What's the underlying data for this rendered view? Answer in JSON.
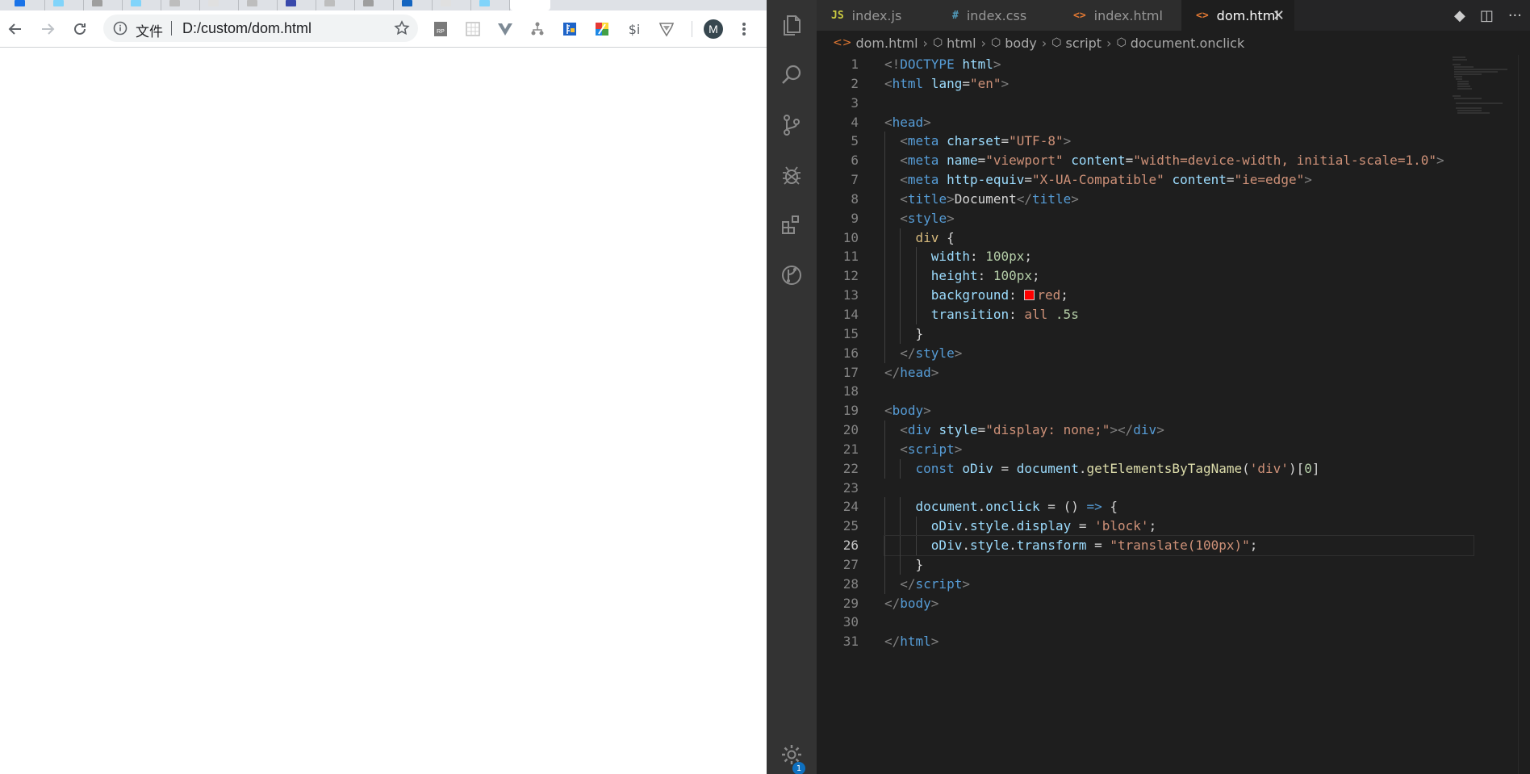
{
  "browser": {
    "tabs": [
      {
        "color": "#1a73e8"
      },
      {
        "color": "#81d4fa"
      },
      {
        "color": "#9e9e9e"
      },
      {
        "color": "#81d4fa"
      },
      {
        "color": "#bdbdbd"
      },
      {
        "color": "#e0e0e0"
      },
      {
        "color": "#bdbdbd"
      },
      {
        "color": "#3949ab"
      },
      {
        "color": "#bdbdbd"
      },
      {
        "color": "#9e9e9e"
      },
      {
        "color": "#1565c0"
      },
      {
        "color": "#e0e0e0"
      },
      {
        "color": "#81d4fa"
      }
    ],
    "address": {
      "security_chip": "文件",
      "url": "D:/custom/dom.html"
    },
    "extensions": [
      {
        "icon": "rp-icon",
        "label": ""
      },
      {
        "icon": "grid-icon",
        "label": ""
      },
      {
        "icon": "vue-devtools-icon",
        "label": ""
      },
      {
        "icon": "tree-icon",
        "label": ""
      },
      {
        "icon": "ruler-icon",
        "label": ""
      },
      {
        "icon": "colorful-square-icon",
        "label": ""
      },
      {
        "icon": "dollar-i-icon",
        "label": "$i"
      },
      {
        "icon": "shield-icon",
        "label": ""
      }
    ],
    "profile_initial": "M"
  },
  "vscode": {
    "tabs": [
      {
        "icon_text": "JS",
        "icon_color": "#cbcb41",
        "label": "index.js"
      },
      {
        "icon_text": "#",
        "icon_color": "#519aba",
        "label": "index.css"
      },
      {
        "icon_text": "<>",
        "icon_color": "#e37933",
        "label": "index.html"
      },
      {
        "icon_text": "<>",
        "icon_color": "#e37933",
        "label": "dom.html",
        "active": true
      }
    ],
    "breadcrumbs": [
      "dom.html",
      "html",
      "body",
      "script",
      "document.onclick"
    ],
    "notification_count": "1",
    "current_line": 26,
    "code_lines": [
      [
        [
          "t-bkt",
          "<!"
        ],
        [
          "t-tag",
          "DOCTYPE "
        ],
        [
          "t-attr",
          "html"
        ],
        [
          "t-bkt",
          ">"
        ]
      ],
      [
        [
          "t-bkt",
          "<"
        ],
        [
          "t-tag",
          "html "
        ],
        [
          "t-attr",
          "lang"
        ],
        [
          "t-txt",
          "="
        ],
        [
          "t-str",
          "\"en\""
        ],
        [
          "t-bkt",
          ">"
        ]
      ],
      [],
      [
        [
          "t-bkt",
          "<"
        ],
        [
          "t-tag",
          "head"
        ],
        [
          "t-bkt",
          ">"
        ]
      ],
      [
        [
          "t-txt",
          "  "
        ],
        [
          "t-bkt",
          "<"
        ],
        [
          "t-tag",
          "meta "
        ],
        [
          "t-attr",
          "charset"
        ],
        [
          "t-txt",
          "="
        ],
        [
          "t-str",
          "\"UTF-8\""
        ],
        [
          "t-bkt",
          ">"
        ]
      ],
      [
        [
          "t-txt",
          "  "
        ],
        [
          "t-bkt",
          "<"
        ],
        [
          "t-tag",
          "meta "
        ],
        [
          "t-attr",
          "name"
        ],
        [
          "t-txt",
          "="
        ],
        [
          "t-str",
          "\"viewport\" "
        ],
        [
          "t-attr",
          "content"
        ],
        [
          "t-txt",
          "="
        ],
        [
          "t-str",
          "\"width=device-width, initial-scale=1.0\""
        ],
        [
          "t-bkt",
          ">"
        ]
      ],
      [
        [
          "t-txt",
          "  "
        ],
        [
          "t-bkt",
          "<"
        ],
        [
          "t-tag",
          "meta "
        ],
        [
          "t-attr",
          "http-equiv"
        ],
        [
          "t-txt",
          "="
        ],
        [
          "t-str",
          "\"X-UA-Compatible\" "
        ],
        [
          "t-attr",
          "content"
        ],
        [
          "t-txt",
          "="
        ],
        [
          "t-str",
          "\"ie=edge\""
        ],
        [
          "t-bkt",
          ">"
        ]
      ],
      [
        [
          "t-txt",
          "  "
        ],
        [
          "t-bkt",
          "<"
        ],
        [
          "t-tag",
          "title"
        ],
        [
          "t-bkt",
          ">"
        ],
        [
          "t-txt",
          "Document"
        ],
        [
          "t-bkt",
          "</"
        ],
        [
          "t-tag",
          "title"
        ],
        [
          "t-bkt",
          ">"
        ]
      ],
      [
        [
          "t-txt",
          "  "
        ],
        [
          "t-bkt",
          "<"
        ],
        [
          "t-tag",
          "style"
        ],
        [
          "t-bkt",
          ">"
        ]
      ],
      [
        [
          "t-txt",
          "    "
        ],
        [
          "t-sel",
          "div"
        ],
        [
          "t-txt",
          " {"
        ]
      ],
      [
        [
          "t-txt",
          "      "
        ],
        [
          "t-attr",
          "width"
        ],
        [
          "t-txt",
          ": "
        ],
        [
          "t-num",
          "100px"
        ],
        [
          "t-txt",
          ";"
        ]
      ],
      [
        [
          "t-txt",
          "      "
        ],
        [
          "t-attr",
          "height"
        ],
        [
          "t-txt",
          ": "
        ],
        [
          "t-num",
          "100px"
        ],
        [
          "t-txt",
          ";"
        ]
      ],
      [
        [
          "t-txt",
          "      "
        ],
        [
          "t-attr",
          "background"
        ],
        [
          "t-txt",
          ": "
        ],
        [
          "swatch",
          ""
        ],
        [
          "t-str",
          "red"
        ],
        [
          "t-txt",
          ";"
        ]
      ],
      [
        [
          "t-txt",
          "      "
        ],
        [
          "t-attr",
          "transition"
        ],
        [
          "t-txt",
          ": "
        ],
        [
          "t-str",
          "all "
        ],
        [
          "t-num",
          ".5s"
        ]
      ],
      [
        [
          "t-txt",
          "    }"
        ]
      ],
      [
        [
          "t-txt",
          "  "
        ],
        [
          "t-bkt",
          "</"
        ],
        [
          "t-tag",
          "style"
        ],
        [
          "t-bkt",
          ">"
        ]
      ],
      [
        [
          "t-bkt",
          "</"
        ],
        [
          "t-tag",
          "head"
        ],
        [
          "t-bkt",
          ">"
        ]
      ],
      [],
      [
        [
          "t-bkt",
          "<"
        ],
        [
          "t-tag",
          "body"
        ],
        [
          "t-bkt",
          ">"
        ]
      ],
      [
        [
          "t-txt",
          "  "
        ],
        [
          "t-bkt",
          "<"
        ],
        [
          "t-tag",
          "div "
        ],
        [
          "t-attr",
          "style"
        ],
        [
          "t-txt",
          "="
        ],
        [
          "t-str",
          "\"display: none;\""
        ],
        [
          "t-bkt",
          "></"
        ],
        [
          "t-tag",
          "div"
        ],
        [
          "t-bkt",
          ">"
        ]
      ],
      [
        [
          "t-txt",
          "  "
        ],
        [
          "t-bkt",
          "<"
        ],
        [
          "t-tag",
          "script"
        ],
        [
          "t-bkt",
          ">"
        ]
      ],
      [
        [
          "t-txt",
          "    "
        ],
        [
          "t-kw",
          "const "
        ],
        [
          "t-var",
          "oDiv"
        ],
        [
          "t-txt",
          " = "
        ],
        [
          "t-var",
          "document"
        ],
        [
          "t-txt",
          "."
        ],
        [
          "t-fn",
          "getElementsByTagName"
        ],
        [
          "t-txt",
          "("
        ],
        [
          "t-str",
          "'div'"
        ],
        [
          "t-txt",
          ")["
        ],
        [
          "t-num",
          "0"
        ],
        [
          "t-txt",
          "]"
        ]
      ],
      [],
      [
        [
          "t-txt",
          "    "
        ],
        [
          "t-var",
          "document"
        ],
        [
          "t-txt",
          "."
        ],
        [
          "t-var",
          "onclick"
        ],
        [
          "t-txt",
          " = () "
        ],
        [
          "t-kw",
          "=>"
        ],
        [
          "t-txt",
          " {"
        ]
      ],
      [
        [
          "t-txt",
          "      "
        ],
        [
          "t-var",
          "oDiv"
        ],
        [
          "t-txt",
          "."
        ],
        [
          "t-var",
          "style"
        ],
        [
          "t-txt",
          "."
        ],
        [
          "t-var",
          "display"
        ],
        [
          "t-txt",
          " = "
        ],
        [
          "t-str",
          "'block'"
        ],
        [
          "t-txt",
          ";"
        ]
      ],
      [
        [
          "t-txt",
          "      "
        ],
        [
          "t-var",
          "oDiv"
        ],
        [
          "t-txt",
          "."
        ],
        [
          "t-var",
          "style"
        ],
        [
          "t-txt",
          "."
        ],
        [
          "t-var",
          "transform"
        ],
        [
          "t-txt",
          " = "
        ],
        [
          "t-str",
          "\"translate(100px)\""
        ],
        [
          "t-txt",
          ";"
        ]
      ],
      [
        [
          "t-txt",
          "    }"
        ]
      ],
      [
        [
          "t-txt",
          "  "
        ],
        [
          "t-bkt",
          "</"
        ],
        [
          "t-tag",
          "script"
        ],
        [
          "t-bkt",
          ">"
        ]
      ],
      [
        [
          "t-bkt",
          "</"
        ],
        [
          "t-tag",
          "body"
        ],
        [
          "t-bkt",
          ">"
        ]
      ],
      [],
      [
        [
          "t-bkt",
          "</"
        ],
        [
          "t-tag",
          "html"
        ],
        [
          "t-bkt",
          ">"
        ]
      ]
    ]
  }
}
